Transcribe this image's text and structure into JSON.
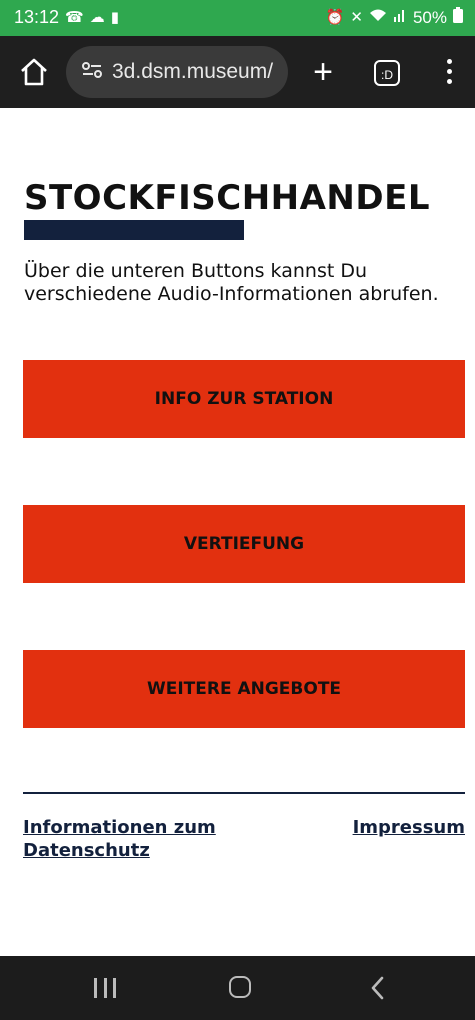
{
  "status_bar": {
    "time": "13:12",
    "battery": "50%",
    "left_icons": [
      "phone-icon",
      "cloud-icon",
      "shopping-bag-icon"
    ],
    "right_icons": [
      "alarm-icon",
      "mute-icon",
      "wifi-icon",
      "signal-icon",
      "battery-icon"
    ]
  },
  "browser": {
    "url": "3d.dsm.museum/",
    "buttons": [
      "home-icon",
      "new-tab-icon",
      "tab-switcher-icon",
      "menu-icon"
    ],
    "tab_label": ":D"
  },
  "page": {
    "title": "STOCKFISCHHANDEL",
    "intro": "Über die unteren Buttons kannst Du verschiedene Audio-Informationen abrufen.",
    "buttons": [
      {
        "label": "INFO ZUR STATION"
      },
      {
        "label": "VERTIEFUNG"
      },
      {
        "label": "WEITERE ANGEBOTE"
      }
    ],
    "footer": {
      "privacy_link": "Informationen zum Datenschutz",
      "imprint_link": "Impressum"
    }
  },
  "colors": {
    "status_bar": "#2fa84f",
    "browser_bar": "#1f1f1f",
    "button_bg": "#e2300f",
    "accent_navy": "#13213d",
    "nav_bar": "#1c1c1c"
  },
  "nav_bar": {
    "icons": [
      "recent-apps-icon",
      "home-nav-icon",
      "back-icon"
    ]
  }
}
